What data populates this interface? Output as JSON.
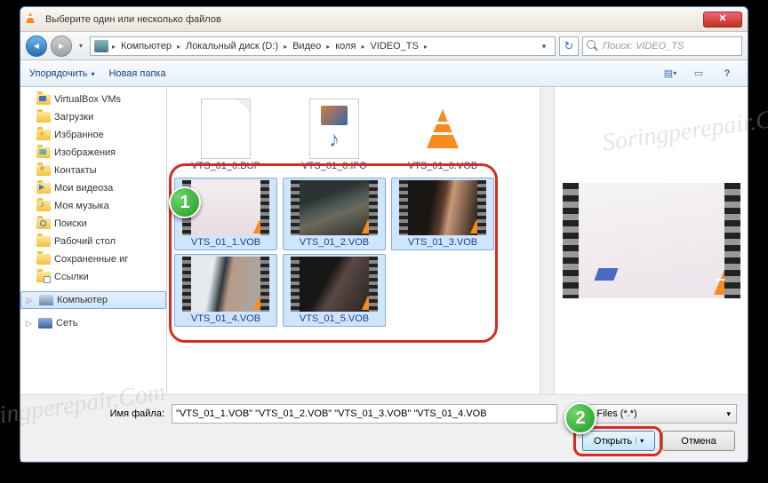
{
  "title": "Выберите один или несколько файлов",
  "breadcrumbs": [
    "Компьютер",
    "Локальный диск (D:)",
    "Видео",
    "коля",
    "VIDEO_TS"
  ],
  "search_placeholder": "Поиск: VIDEO_TS",
  "toolbar": {
    "organize": "Упорядочить",
    "new_folder": "Новая папка"
  },
  "sidebar": {
    "items": [
      "VirtualBox VMs",
      "Загрузки",
      "Избранное",
      "Изображения",
      "Контакты",
      "Мои видеоза",
      "Моя музыка",
      "Поиски",
      "Рабочий стол",
      "Сохраненные иг",
      "Ссылки"
    ],
    "computer": "Компьютер",
    "network": "Сеть"
  },
  "files": [
    {
      "name": "VTS_01_0.BUP",
      "type": "generic",
      "selected": false
    },
    {
      "name": "VTS_01_0.IFO",
      "type": "ifo",
      "selected": false
    },
    {
      "name": "VTS_01_0.VOB",
      "type": "cone",
      "selected": false
    },
    {
      "name": "VTS_01_1.VOB",
      "type": "video",
      "frame": "f1",
      "selected": true
    },
    {
      "name": "VTS_01_2.VOB",
      "type": "video",
      "frame": "f2",
      "selected": true
    },
    {
      "name": "VTS_01_3.VOB",
      "type": "video",
      "frame": "f3",
      "selected": true
    },
    {
      "name": "VTS_01_4.VOB",
      "type": "video",
      "frame": "f4",
      "selected": true
    },
    {
      "name": "VTS_01_5.VOB",
      "type": "video",
      "frame": "f5",
      "selected": true
    }
  ],
  "filename_label": "Имя файла:",
  "filename_value": "\"VTS_01_1.VOB\" \"VTS_01_2.VOB\" \"VTS_01_3.VOB\" \"VTS_01_4.VOB",
  "filter_value": "l Files (*.*)",
  "open_btn": "Открыть",
  "cancel_btn": "Отмена",
  "callouts": {
    "one": "1",
    "two": "2"
  },
  "watermark": "Soringperepair.Com"
}
